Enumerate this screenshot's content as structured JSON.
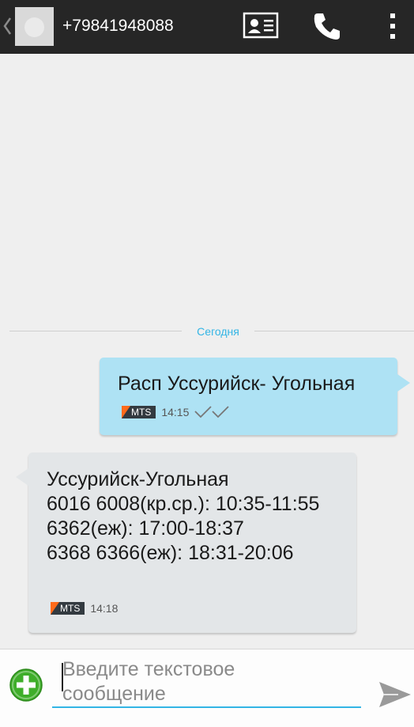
{
  "header": {
    "title": "+79841948088",
    "icons": [
      "back-chevron-icon",
      "contact-avatar",
      "contact-card-icon",
      "phone-icon",
      "overflow-menu-icon"
    ]
  },
  "conversation": {
    "date_label": "Сегодня",
    "messages": [
      {
        "direction": "outgoing",
        "lines": [
          "Расп Уссурийск- Угольная"
        ],
        "carrier": "MTS",
        "time": "14:15",
        "status": "delivered"
      },
      {
        "direction": "incoming",
        "lines": [
          "Уссурийск-Угольная",
          "6016 6008(кр.ср.): 10:35-11:55",
          "6362(еж): 17:00-18:37",
          "6368 6366(еж): 18:31-20:06"
        ],
        "carrier": "MTS",
        "time": "14:18"
      }
    ]
  },
  "composer": {
    "placeholder_line1": "Введите текстовое",
    "placeholder_line2": "сообщение",
    "icons": [
      "attach-plus-icon",
      "send-icon"
    ]
  },
  "colors": {
    "actionbar": "#262626",
    "accent": "#33b5e5",
    "outgoing_bubble": "#aee2f4",
    "incoming_bubble": "#e3e6e8",
    "attach_green": "#3fae2a",
    "carrier_orange": "#ff6a1a"
  }
}
